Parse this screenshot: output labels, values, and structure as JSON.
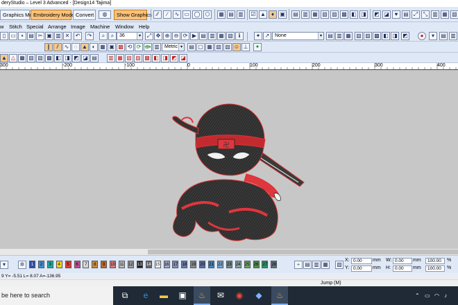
{
  "window": {
    "title": "deryStudio – Level 3 Advanced - [Design14      Tajima]"
  },
  "toolbar": {
    "graphics_mode": "Graphics Mode",
    "embroidery_mode": "Embroidery Mode",
    "convert": "Convert",
    "show_graphics": "Show Graphics",
    "zoom_value": "36",
    "units": "Metric",
    "none_combo": "None"
  },
  "menu": {
    "items": [
      "w",
      "Stitch",
      "Special",
      "Arrange",
      "Image",
      "Machine",
      "Window",
      "Help"
    ]
  },
  "ruler": {
    "labels": [
      "300",
      "-200",
      "-100",
      "0",
      "100",
      "200",
      "300",
      "400"
    ]
  },
  "palette": {
    "swatches": [
      {
        "label": "1",
        "color": "#2d4fa8"
      },
      {
        "label": "2",
        "color": "#3b8fd6"
      },
      {
        "label": "3",
        "color": "#1ea7a2"
      },
      {
        "label": "4",
        "color": "#f2d40c"
      },
      {
        "label": "5",
        "color": "#e23a2f"
      },
      {
        "label": "6",
        "color": "#c04a8e"
      },
      {
        "label": "7",
        "color": "#d8d8d8"
      },
      {
        "label": "8",
        "color": "#c9893c"
      },
      {
        "label": "9",
        "color": "#c46524"
      },
      {
        "label": "10",
        "color": "#d57b7b"
      },
      {
        "label": "11",
        "color": "#b9b9b9"
      },
      {
        "label": "12",
        "color": "#9a9a9a"
      },
      {
        "label": "13",
        "color": "#222222"
      },
      {
        "label": "14",
        "color": "#666666"
      },
      {
        "label": "15",
        "color": "#ffffff"
      },
      {
        "label": "16",
        "color": "#9fa6c8"
      },
      {
        "label": "17",
        "color": "#7f8fbf"
      },
      {
        "label": "18",
        "color": "#6b7aa6"
      },
      {
        "label": "19",
        "color": "#8a8a8a"
      },
      {
        "label": "20",
        "color": "#5c6ea0"
      },
      {
        "label": "21",
        "color": "#3d83c5"
      },
      {
        "label": "22",
        "color": "#7aa3c9"
      },
      {
        "label": "23",
        "color": "#6a8a8a"
      },
      {
        "label": "24",
        "color": "#8aa0a0"
      },
      {
        "label": "25",
        "color": "#6ba55a"
      },
      {
        "label": "26",
        "color": "#4e8f49"
      },
      {
        "label": "27",
        "color": "#2f8f6a"
      },
      {
        "label": "28",
        "color": "#5f6f7f"
      }
    ],
    "x_label": "X:",
    "x_value": "0.00",
    "y_label": "Y:",
    "y_value": "0.00",
    "unit1": "mm",
    "unit2": "mm",
    "w_label": "W:",
    "w_value": "0.00",
    "h_label": "H:",
    "h_value": "0.00",
    "unit3": "mm",
    "unit4": "mm",
    "pct1": "100.00",
    "pct2": "100.00",
    "pct_sign": "%"
  },
  "status": {
    "coords": "9  Y=  -5.51  L=  8.07  A=-136.95",
    "mode": "Jump (M)"
  },
  "taskbar": {
    "search": "be here to search"
  }
}
